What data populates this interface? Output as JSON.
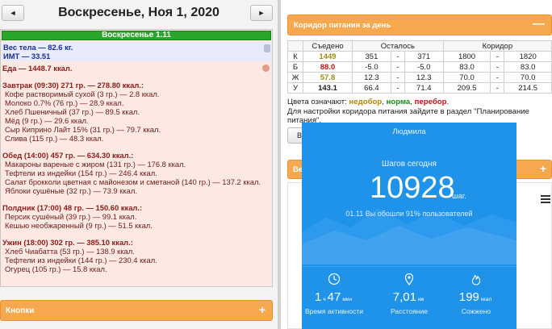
{
  "header": {
    "prev_label": "◄",
    "next_label": "►",
    "date_title": "Воскресенье, Ноя 1, 2020"
  },
  "day_panel": {
    "day_bar": "Воскресенье 1.11",
    "weight": "Вес тела — 82.6 кг.",
    "bmi": "ИМТ — 33.51",
    "total": "Еда — 1448.7 ккал.",
    "meals": [
      {
        "head": "Завтрак (09:30) 271 гр. — 278.80 ккал.:",
        "items": [
          "Кофе растворимый сухой (3 гр.) — 2.8 ккал.",
          "Молоко 0.7% (76 гр.) — 28.9 ккал.",
          "Хлеб Пшеничный (37 гр.) — 89.5 ккал.",
          "Мёд (9 гр.) — 29.6 ккал.",
          "Сыр Киприно Лайт 15% (31 гр.) — 79.7 ккал.",
          "Слива (115 гр.) — 48.3 ккал."
        ]
      },
      {
        "head": "Обед (14:00) 457 гр. — 634.30 ккал.:",
        "items": [
          "Макароны вареные с жиром (131 гр.) — 176.8 ккал.",
          "Тефтели из индейки (154 гр.) — 246.4 ккал.",
          "Салат брокколи цветная с майонезом и сметаной (140 гр.) — 137.2 ккал.",
          "Яблоки сушёные (32 гр.) — 73.9 ккал."
        ]
      },
      {
        "head": "Полдник (17:00) 48 гр. — 150.60 ккал.:",
        "items": [
          "Персик сушёный (39 гр.) — 99.1 ккал.",
          "Кешью необжаренный (9 гр.) — 51.5 ккал."
        ]
      },
      {
        "head": "Ужин (18:00) 302 гр. — 385.10 ккал.:",
        "items": [
          "Хлеб Чиабатта (53 гр.) — 138.9 ккал.",
          "Тефтели из индейки (144 гр.) — 230.4 ккал.",
          "Огурец (105 гр.) — 15.8 ккал."
        ]
      }
    ]
  },
  "buttons_panel": {
    "title": "Кнопки",
    "toggle": "+"
  },
  "corridor": {
    "header": "Коридор питания за день",
    "toggle": "—",
    "columns": [
      "Съедено",
      "Осталось",
      "Коридор"
    ],
    "rows": [
      {
        "letter": "К",
        "eaten": "1449",
        "eaten_color": "#9b8c12",
        "left_min": "351",
        "sep1": "-",
        "left_max": "371",
        "c_min": "1800",
        "sep2": "-",
        "c_max": "1820"
      },
      {
        "letter": "Б",
        "eaten": "88.0",
        "eaten_color": "#c01414",
        "left_min": "-5.0",
        "sep1": "-",
        "left_max": "-5.0",
        "c_min": "83.0",
        "sep2": "-",
        "c_max": "83.0"
      },
      {
        "letter": "Ж",
        "eaten": "57.8",
        "eaten_color": "#9b8c12",
        "left_min": "12.3",
        "sep1": "-",
        "left_max": "12.3",
        "c_min": "70.0",
        "sep2": "-",
        "c_max": "70.0"
      },
      {
        "letter": "У",
        "eaten": "143.1",
        "eaten_color": "#222222",
        "left_min": "66.4",
        "sep1": "-",
        "left_max": "71.4",
        "c_min": "209.5",
        "sep2": "-",
        "c_max": "214.5"
      }
    ],
    "legend_prefix": "Цвета означают:",
    "legend_under": "недобор",
    "legend_norm": "норма",
    "legend_over": "перебор",
    "hint": "Для настройки коридора питания зайдите в раздел \"Планирование питания\".",
    "go_button": "Ве",
    "lower_header": "Ве",
    "lower_toggle": "+"
  },
  "steps_card": {
    "name": "Людмила",
    "title": "Шагов сегодня",
    "count": "10928",
    "unit": "шаг.",
    "note": "01.11 Вы обошли 91% пользователей",
    "stats": [
      {
        "big1": "1",
        "small1": "ч",
        "big2": "47",
        "small2": "мин",
        "label": "Время активности"
      },
      {
        "big1": "7,01",
        "small1": "км",
        "big2": "",
        "small2": "",
        "label": "Расстояние"
      },
      {
        "big1": "199",
        "small1": "ккал",
        "big2": "",
        "small2": "",
        "label": "Сожжено"
      }
    ]
  },
  "colors": {
    "orange_header": "#f6a84e",
    "green_bar": "#2ba52b",
    "steps_blue": "#1f93ea",
    "day_bg": "#fde9e1",
    "weight_bg": "#e7ebfb"
  }
}
